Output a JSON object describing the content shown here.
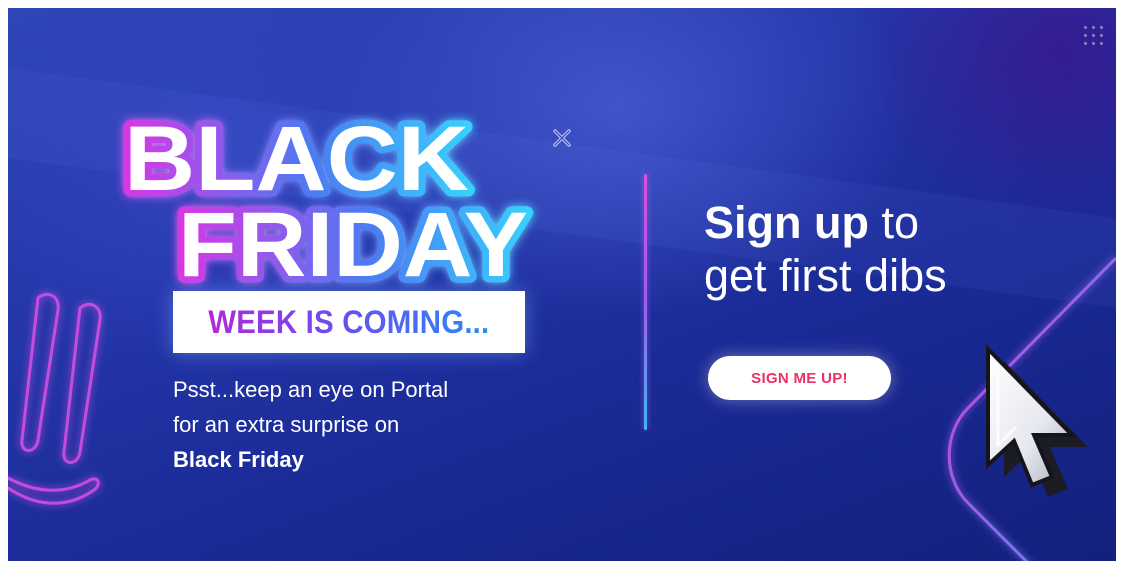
{
  "banner": {
    "headline": {
      "line1": "BLACK",
      "line2": "FRIDAY"
    },
    "subheadline": "WEEK IS COMING...",
    "description": {
      "line1": "Psst...keep an eye on Portal",
      "line2": "for an extra surprise on",
      "line3": "Black Friday"
    },
    "cta": {
      "title_bold": "Sign up",
      "title_rest": " to",
      "title_line2": "get first dibs",
      "button_label": "SIGN ME UP!"
    },
    "icons": {
      "close": "close-icon",
      "grid": "grid-dots-icon",
      "cursor": "mouse-pointer-icon"
    },
    "colors": {
      "background": "#1b2b98",
      "button_text": "#ee2f66",
      "neon_pink": "#e040e8",
      "neon_blue": "#3fc0ff"
    }
  }
}
